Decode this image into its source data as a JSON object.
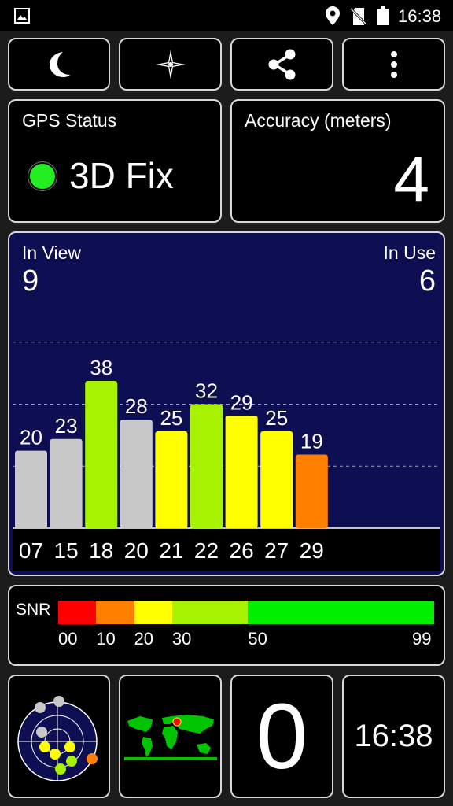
{
  "status_bar": {
    "time": "16:38",
    "icons": [
      "image-notification-icon",
      "location-icon",
      "no-sim-icon",
      "battery-icon"
    ]
  },
  "toolbar": {
    "buttons": [
      {
        "name": "night-mode",
        "icon": "moon-icon"
      },
      {
        "name": "compass",
        "icon": "compass-star-icon"
      },
      {
        "name": "share",
        "icon": "share-icon"
      },
      {
        "name": "more",
        "icon": "overflow-menu-icon"
      }
    ]
  },
  "gps_status": {
    "title": "GPS Status",
    "value": "3D Fix",
    "indicator_color": "#22ee22"
  },
  "accuracy": {
    "title": "Accuracy (meters)",
    "value": "4"
  },
  "satellites": {
    "in_view_label": "In View",
    "in_view_value": "9",
    "in_use_label": "In Use",
    "in_use_value": "6"
  },
  "chart_data": {
    "type": "bar",
    "categories": [
      "07",
      "15",
      "18",
      "20",
      "21",
      "22",
      "26",
      "27",
      "29"
    ],
    "values": [
      20,
      23,
      38,
      28,
      25,
      32,
      29,
      25,
      19
    ],
    "colors": [
      "#c8c8c8",
      "#c8c8c8",
      "#a6f200",
      "#c8c8c8",
      "#ffff00",
      "#a6f200",
      "#ffff00",
      "#ffff00",
      "#ff8000"
    ],
    "title": "",
    "xlabel": "",
    "ylabel": "",
    "ylim": [
      0,
      64
    ],
    "grid": true
  },
  "snr_legend": {
    "label": "SNR",
    "segments": [
      {
        "from": 0,
        "to": 10,
        "color": "#ff0000"
      },
      {
        "from": 10,
        "to": 20,
        "color": "#ff8000"
      },
      {
        "from": 20,
        "to": 30,
        "color": "#ffff00"
      },
      {
        "from": 30,
        "to": 50,
        "color": "#a6f200"
      },
      {
        "from": 50,
        "to": 99,
        "color": "#00ee00"
      }
    ],
    "ticks": [
      "00",
      "10",
      "20",
      "30",
      "50",
      "99"
    ]
  },
  "bottom": {
    "radar_icon": "sky-radar-icon",
    "map_icon": "world-map-icon",
    "speed": "0",
    "time": "16:38"
  }
}
